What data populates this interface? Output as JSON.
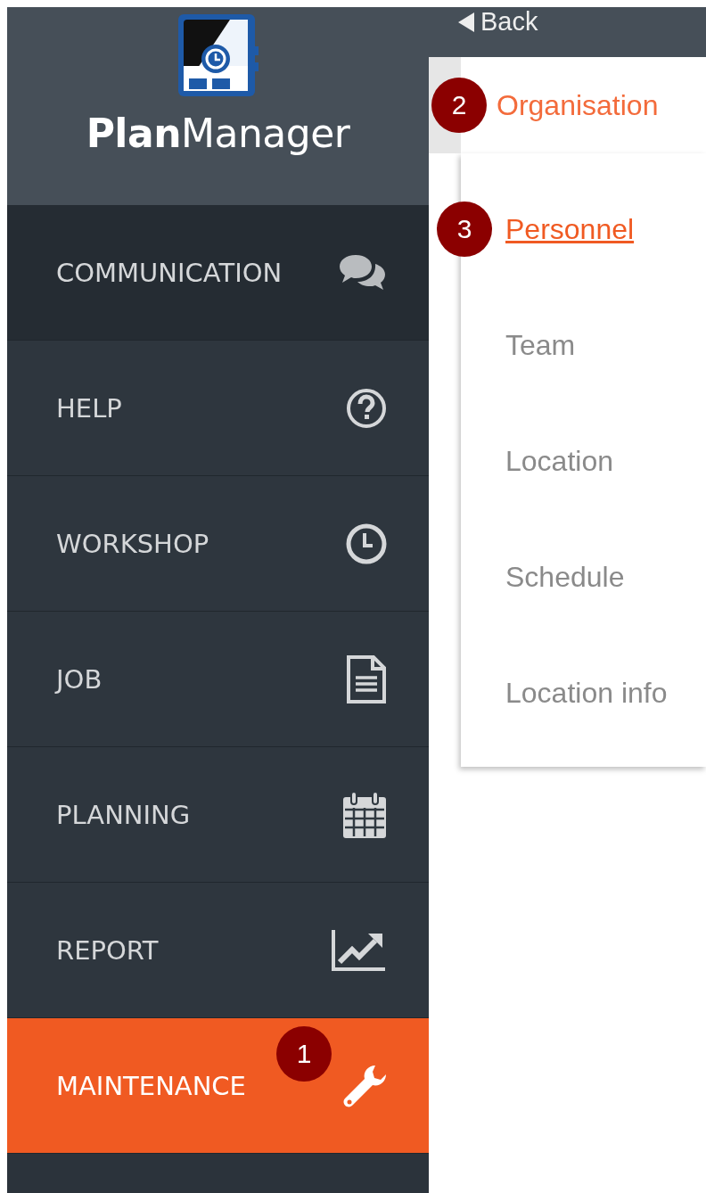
{
  "sidebar": {
    "brand": "**Plan**Manager",
    "items": [
      {
        "label": "COMMUNICATION",
        "selected": false
      },
      {
        "label": "HELP",
        "selected": false
      },
      {
        "label": "WORKSHOP",
        "selected": false
      },
      {
        "label": "JOB",
        "selected": false
      },
      {
        "label": "PLANNING",
        "selected": false
      },
      {
        "label": "REPORT",
        "selected": false
      },
      {
        "label": "MAINTENANCE",
        "selected": true,
        "badge": "1"
      }
    ]
  },
  "submenu": {
    "back": "Back",
    "section": {
      "label": "Organisation",
      "selected": true,
      "badge": "2"
    },
    "items": [
      {
        "label": "Personnel",
        "selected": true,
        "badge": "3"
      },
      {
        "label": "Team",
        "selected": false
      },
      {
        "label": "Location",
        "selected": false
      },
      {
        "label": "Schedule",
        "selected": false
      },
      {
        "label": "Location info",
        "selected": false
      }
    ]
  }
}
